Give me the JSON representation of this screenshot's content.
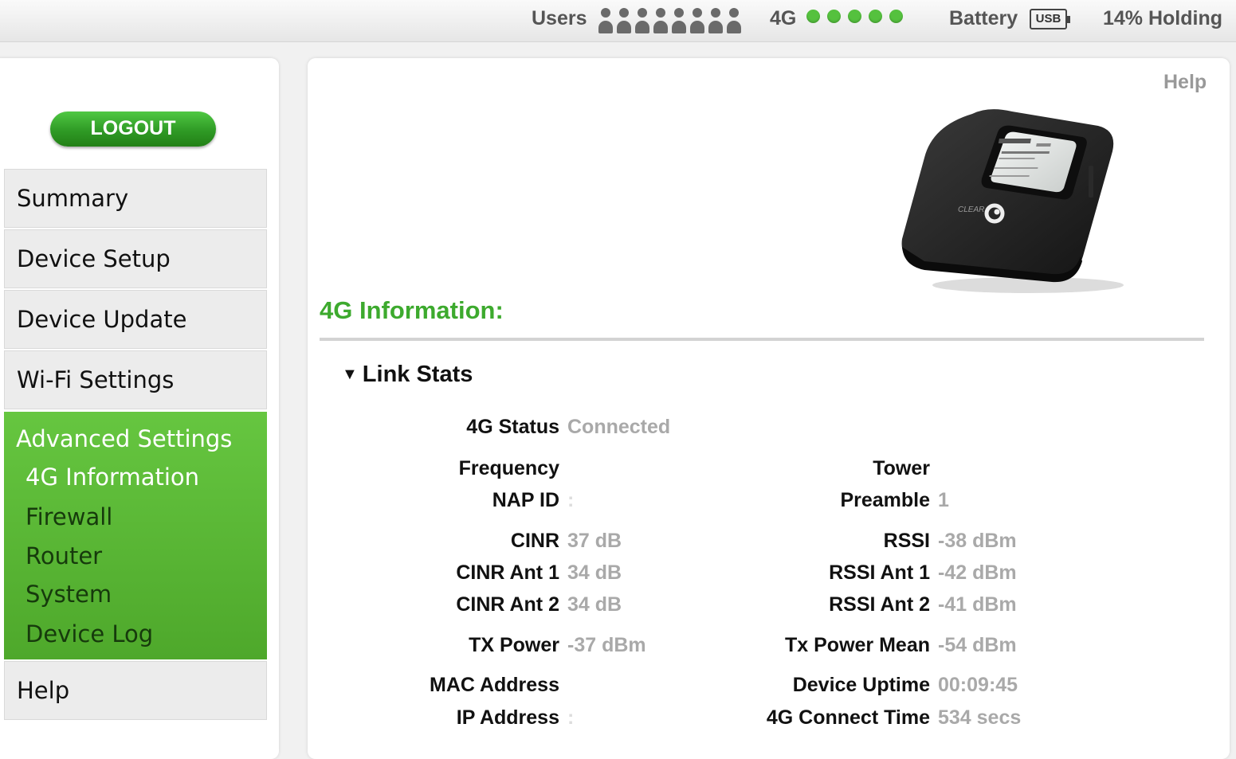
{
  "status_bar": {
    "users_label": "Users",
    "users_icon_count": 8,
    "network_label": "4G",
    "signal_bars": 5,
    "battery_label": "Battery",
    "battery_icon_text": "USB",
    "battery_status": "14% Holding",
    "icons": [
      "user-icon",
      "signal-dot-icon",
      "battery-usb-icon"
    ],
    "colors": {
      "signal": "#55c13e"
    }
  },
  "sidebar": {
    "logout_label": "LOGOUT",
    "items": [
      "Summary",
      "Device Setup",
      "Device Update",
      "Wi-Fi Settings"
    ],
    "advanced": {
      "label": "Advanced Settings",
      "subitems": [
        "4G Information",
        "Firewall",
        "Router",
        "System",
        "Device Log"
      ],
      "active_subitem": "4G Information"
    },
    "help_label": "Help",
    "colors": {
      "advanced_bg": "#5bb736",
      "logout_bg": "#36a32a"
    }
  },
  "main": {
    "help_link": "Help",
    "device_brand": "CLEAR",
    "section_title": "4G Information:",
    "subsection_toggle": "Link Stats",
    "stats": {
      "status": {
        "label": "4G Status",
        "value": "Connected"
      },
      "frequency": {
        "label": "Frequency",
        "value": ""
      },
      "nap_id": {
        "label": "NAP ID",
        "value": ":"
      },
      "cinr": {
        "label": "CINR",
        "value": "37 dB"
      },
      "cinr_ant1": {
        "label": "CINR Ant 1",
        "value": "34 dB"
      },
      "cinr_ant2": {
        "label": "CINR Ant 2",
        "value": "34 dB"
      },
      "tx_power": {
        "label": "TX Power",
        "value": "-37 dBm"
      },
      "mac": {
        "label": "MAC Address",
        "value": ""
      },
      "ip": {
        "label": "IP Address",
        "value": ":"
      },
      "tower": {
        "label": "Tower",
        "value": ""
      },
      "preamble": {
        "label": "Preamble",
        "value": "1"
      },
      "rssi": {
        "label": "RSSI",
        "value": "-38 dBm"
      },
      "rssi_ant1": {
        "label": "RSSI Ant 1",
        "value": "-42 dBm"
      },
      "rssi_ant2": {
        "label": "RSSI Ant 2",
        "value": "-41 dBm"
      },
      "tx_power_mean": {
        "label": "Tx Power Mean",
        "value": "-54 dBm"
      },
      "uptime": {
        "label": "Device Uptime",
        "value": "00:09:45"
      },
      "connect_time": {
        "label": "4G Connect Time",
        "value": "534 secs"
      }
    },
    "colors": {
      "title": "#3daa2e",
      "value_text": "#a9a9a9"
    }
  }
}
